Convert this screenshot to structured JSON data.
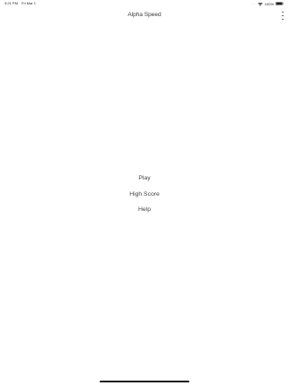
{
  "status_bar": {
    "time": "3:21 PM",
    "date": "Fri Mar 1",
    "more_dots": "···",
    "wifi_icon": "wifi-icon",
    "battery_percent": "100%",
    "battery_icon": "battery-full-icon"
  },
  "header": {
    "title": "Alpha Speed",
    "menu_icon": "more-vertical-icon"
  },
  "menu": {
    "items": [
      {
        "label": "Play"
      },
      {
        "label": "High Score"
      },
      {
        "label": "Help"
      }
    ]
  },
  "colors": {
    "background": "#ffffff",
    "text": "#444444",
    "home_indicator": "#1a1a1a"
  }
}
